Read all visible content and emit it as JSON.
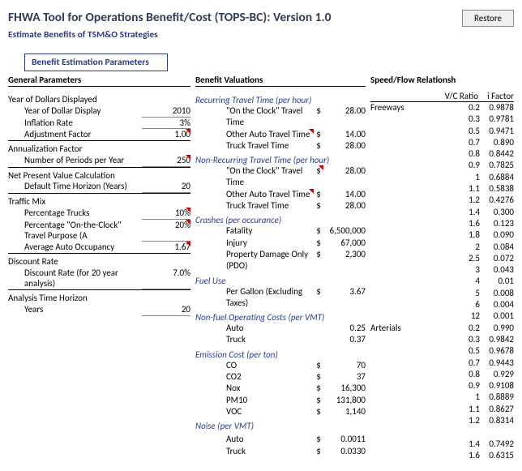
{
  "header": {
    "title": "FHWA Tool for Operations Benefit/Cost (TOPS-BC):  Version 1.0",
    "subtitle": "Estimate Benefits of TSM&O Strategies",
    "restore": "Restore",
    "params": "Benefit Estimation Parameters"
  },
  "columns": {
    "c1": "General Parameters",
    "c2": "Benefit Valuations",
    "c3": "Speed/Flow Relationsh"
  },
  "gp": {
    "g1": {
      "hdr": "Year of Dollars Displayed",
      "r1l": "Year of Dollar Display",
      "r1v": "2010",
      "r2l": "Inflation Rate",
      "r2v": "3%",
      "r3l": "Adjustment Factor",
      "r3v": "1.00"
    },
    "g2": {
      "hdr": "Annualization Factor",
      "r1l": "Number of Periods per Year",
      "r1v": "250"
    },
    "g3": {
      "hdr": "Net Present Value Calculation",
      "r1l": "Default Time Horizon (Years)",
      "r1v": "20"
    },
    "g4": {
      "hdr": "Traffic Mix",
      "r1l": "Percentage Trucks",
      "r1v": "10%",
      "r2l": "Percentage \"On-the-Clock\" Travel Purpose (A",
      "r2v": "20%",
      "r3l": "Average Auto Occupancy",
      "r3v": "1.67"
    },
    "g5": {
      "hdr": "Discount Rate",
      "r1l": "Discount Rate (for 20 year analysis)",
      "r1v": "7.0%"
    },
    "g6": {
      "hdr": "Analysis Time Horizon",
      "r1l": "Years",
      "r1v": "20"
    }
  },
  "bv": {
    "s1": {
      "hdr": "Recurring Travel Time (per hour)",
      "r1l": "\"On the Clock\" Travel Time",
      "r1d": "$",
      "r1v": "28.00",
      "r2l": "Other Auto Travel Time",
      "r2d": "$",
      "r2v": "14.00",
      "r3l": "Truck Travel Time",
      "r3d": "$",
      "r3v": "28.00"
    },
    "s2": {
      "hdr": "Non-Recurring Travel Time (per hour)",
      "r1l": "\"On the Clock\" Travel Time",
      "r1d": "$",
      "r1v": "28.00",
      "r2l": "Other Auto Travel Time",
      "r2d": "$",
      "r2v": "14.00",
      "r3l": "Truck Travel Time",
      "r3d": "$",
      "r3v": "28.00"
    },
    "s3": {
      "hdr": "Crashes (per occurance)",
      "r1l": "Fatality",
      "r1d": "$",
      "r1v": "6,500,000",
      "r2l": "Injury",
      "r2d": "$",
      "r2v": "67,000",
      "r3l": "Property Damage Only (PDO)",
      "r3d": "$",
      "r3v": "2,300"
    },
    "s4": {
      "hdr": "Fuel Use",
      "r1l": "Per Gallon (Excluding Taxes)",
      "r1d": "$",
      "r1v": "3.67"
    },
    "s5": {
      "hdr": "Non-fuel Operating Costs (per VMT)",
      "r1l": "Auto",
      "r1d": "",
      "r1v": "0.25",
      "r2l": "Truck",
      "r2d": "",
      "r2v": "0.37"
    },
    "s6": {
      "hdr": "Emission Cost (per ton)",
      "r1l": "CO",
      "r1d": "$",
      "r1v": "70",
      "r2l": "CO2",
      "r2d": "$",
      "r2v": "37",
      "r3l": "Nox",
      "r3d": "$",
      "r3v": "16,300",
      "r4l": "PM10",
      "r4d": "$",
      "r4v": "131,800",
      "r5l": "VOC",
      "r5d": "$",
      "r5v": "1,140"
    },
    "s7": {
      "hdr": "Noise (per VMT)",
      "r1l": "Auto",
      "r1d": "$",
      "r1v": "0.0011",
      "r2l": "Truck",
      "r2d": "$",
      "r2v": "0.0330"
    }
  },
  "sf": {
    "h1": "V/C Ratio",
    "h2": "i Factor",
    "cat1": "Freeways",
    "cat2": "Arterials",
    "f": [
      [
        "0.2",
        "0.9878"
      ],
      [
        "0.3",
        "0.9781"
      ],
      [
        "0.5",
        "0.9471"
      ],
      [
        "0.7",
        "0.890"
      ],
      [
        "0.8",
        "0.8442"
      ],
      [
        "0.9",
        "0.7825"
      ],
      [
        "1",
        "0.6884"
      ],
      [
        "1.1",
        "0.5838"
      ],
      [
        "1.2",
        "0.4276"
      ],
      [
        "1.4",
        "0.300"
      ],
      [
        "1.6",
        "0.123"
      ],
      [
        "1.8",
        "0.090"
      ],
      [
        "2",
        "0.084"
      ],
      [
        "2.5",
        "0.072"
      ],
      [
        "3",
        "0.043"
      ],
      [
        "4",
        "0.01"
      ],
      [
        "5",
        "0.008"
      ],
      [
        "6",
        "0.004"
      ],
      [
        "12",
        "0.001"
      ]
    ],
    "a": [
      [
        "0.2",
        "0.990"
      ],
      [
        "0.3",
        "0.9842"
      ],
      [
        "0.5",
        "0.9678"
      ],
      [
        "0.7",
        "0.9443"
      ],
      [
        "0.8",
        "0.929"
      ],
      [
        "0.9",
        "0.9108"
      ],
      [
        "1",
        "0.8889"
      ],
      [
        "1.1",
        "0.8627"
      ],
      [
        "1.2",
        "0.8314"
      ],
      [
        "",
        "&nbsp;"
      ],
      [
        "1.4",
        "0.7492"
      ],
      [
        "1.6",
        "0.6315"
      ]
    ]
  }
}
